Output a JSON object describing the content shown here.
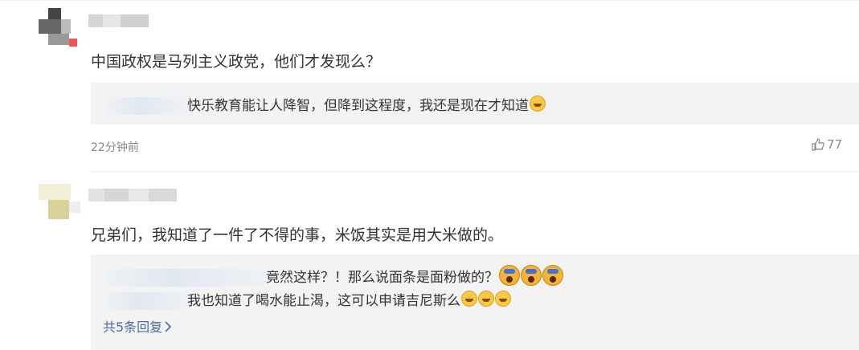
{
  "comments": [
    {
      "text": "中国政权是马列主义政党，他们才发现么？",
      "replies": [
        {
          "text": "快乐教育能让人降智，但降到这程度，我还是现在才知道",
          "emojis": [
            "grin"
          ]
        }
      ],
      "time": "22分钟前",
      "likes": "77"
    },
    {
      "text": "兄弟们，我知道了一件了不得的事，米饭其实是用大米做的。",
      "replies": [
        {
          "text": "竟然这样？！那么说面条是面粉做的？",
          "emojis": [
            "shock",
            "shock",
            "shock"
          ]
        },
        {
          "text": "我也知道了喝水能止渴，这可以申请吉尼斯么",
          "emojis": [
            "grin",
            "grin",
            "grin"
          ]
        }
      ],
      "more_replies": "共5条回复"
    }
  ],
  "colors": {
    "link": "#4a6da8",
    "reply_bg": "#f3f3f3",
    "meta": "#888888"
  },
  "icons": {
    "like": "thumbs-up-icon",
    "more": "chevron-right-icon"
  }
}
